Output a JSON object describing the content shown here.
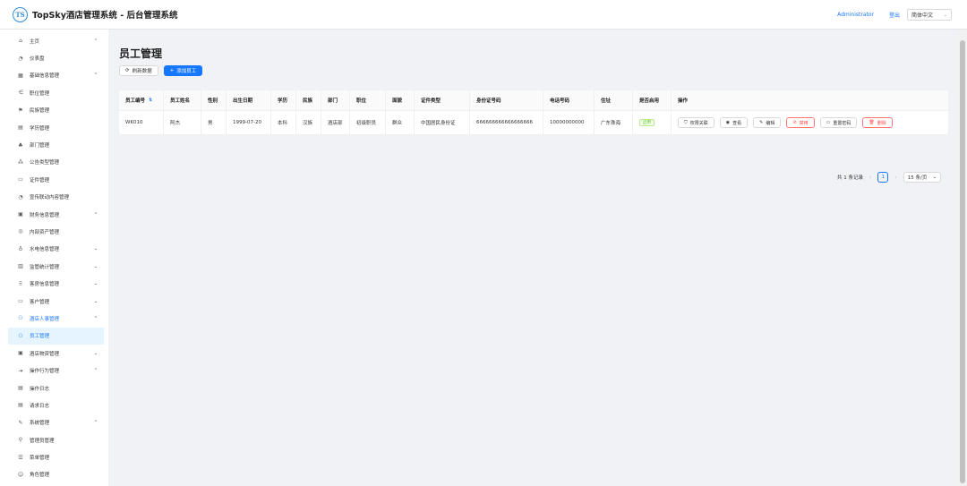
{
  "header": {
    "logo_text": "TS",
    "title": "TopSky酒店管理系统 - 后台管理系统",
    "user": "Administrator",
    "logout": "登出",
    "language": "简体中文"
  },
  "sidebar": {
    "items": [
      {
        "label": "主页",
        "icon": "home-icon",
        "glyph": "⌂",
        "caret": "⌃",
        "level": 0
      },
      {
        "label": "仪表盘",
        "icon": "dashboard-icon",
        "glyph": "◔",
        "level": 1
      },
      {
        "label": "基础信息管理",
        "icon": "grid-icon",
        "glyph": "▦",
        "caret": "⌃",
        "level": 0
      },
      {
        "label": "职位管理",
        "icon": "share-icon",
        "glyph": "⋲",
        "level": 1
      },
      {
        "label": "民族管理",
        "icon": "flag-icon",
        "glyph": "⚑",
        "level": 1
      },
      {
        "label": "学历管理",
        "icon": "book-icon",
        "glyph": "▤",
        "level": 1
      },
      {
        "label": "部门管理",
        "icon": "org-icon",
        "glyph": "♣",
        "level": 1
      },
      {
        "label": "公告类型管理",
        "icon": "cluster-icon",
        "glyph": "⁂",
        "level": 1
      },
      {
        "label": "证件管理",
        "icon": "idcard-icon",
        "glyph": "▭",
        "level": 1
      },
      {
        "label": "宣传联动内容管理",
        "icon": "dashboard-icon",
        "glyph": "◔",
        "level": 1
      },
      {
        "label": "财务信息管理",
        "icon": "account-book-icon",
        "glyph": "▣",
        "caret": "⌃",
        "level": 0
      },
      {
        "label": "内部资产管理",
        "icon": "asset-icon",
        "glyph": "◎",
        "level": 1
      },
      {
        "label": "水电信息管理",
        "icon": "water-icon",
        "glyph": "♁",
        "caret": "⌄",
        "level": 0
      },
      {
        "label": "监管统计管理",
        "icon": "audit-icon",
        "glyph": "▥",
        "caret": "⌄",
        "level": 0
      },
      {
        "label": "客房信息管理",
        "icon": "room-icon",
        "glyph": "⠿",
        "caret": "⌄",
        "level": 0
      },
      {
        "label": "客户管理",
        "icon": "desktop-icon",
        "glyph": "▭",
        "caret": "⌄",
        "level": 0
      },
      {
        "label": "酒店人事管理",
        "icon": "team-icon",
        "glyph": "⚇",
        "caret": "⌃",
        "level": 0,
        "open": true
      },
      {
        "label": "员工管理",
        "icon": "team-icon",
        "glyph": "⚇",
        "level": 1,
        "active": true
      },
      {
        "label": "酒店物资管理",
        "icon": "goods-icon",
        "glyph": "▣",
        "caret": "⌄",
        "level": 0
      },
      {
        "label": "操作行为管理",
        "icon": "export-icon",
        "glyph": "⇥",
        "caret": "⌃",
        "level": 0
      },
      {
        "label": "操作日志",
        "icon": "log-icon",
        "glyph": "▤",
        "level": 1
      },
      {
        "label": "请求日志",
        "icon": "log-icon",
        "glyph": "▤",
        "level": 1
      },
      {
        "label": "系统管理",
        "icon": "tool-icon",
        "glyph": "✎",
        "caret": "⌃",
        "level": 0
      },
      {
        "label": "管理员管理",
        "icon": "key-icon",
        "glyph": "⚲",
        "level": 1
      },
      {
        "label": "菜单管理",
        "icon": "menu-icon",
        "glyph": "☰",
        "level": 1
      },
      {
        "label": "角色管理",
        "icon": "role-icon",
        "glyph": "☺",
        "level": 1
      }
    ]
  },
  "page": {
    "title": "员工管理",
    "refresh_label": "刷新数据",
    "add_label": "添加员工"
  },
  "table": {
    "columns": [
      "员工编号",
      "员工姓名",
      "性别",
      "出生日期",
      "学历",
      "民族",
      "部门",
      "职位",
      "面貌",
      "证件类型",
      "身份证号码",
      "电话号码",
      "住址",
      "是否启用",
      "操作"
    ],
    "rows": [
      {
        "cells": [
          "WK010",
          "阿杰",
          "男",
          "1999-07-20",
          "本科",
          "汉族",
          "酒店部",
          "初级职员",
          "群众",
          "中国居民身份证",
          "666666666666666666",
          "10000000000",
          "广东珠海"
        ],
        "status": "启用"
      }
    ],
    "actions": [
      "权限关联",
      "查看",
      "编辑",
      "禁用",
      "重置密码",
      "删除"
    ]
  },
  "pagination": {
    "total": "共 1 条记录",
    "current": "1",
    "page_size": "15 条/页"
  },
  "colors": {
    "primary": "#1677ff",
    "danger": "#ff4d4f",
    "success": "#52c41a"
  }
}
